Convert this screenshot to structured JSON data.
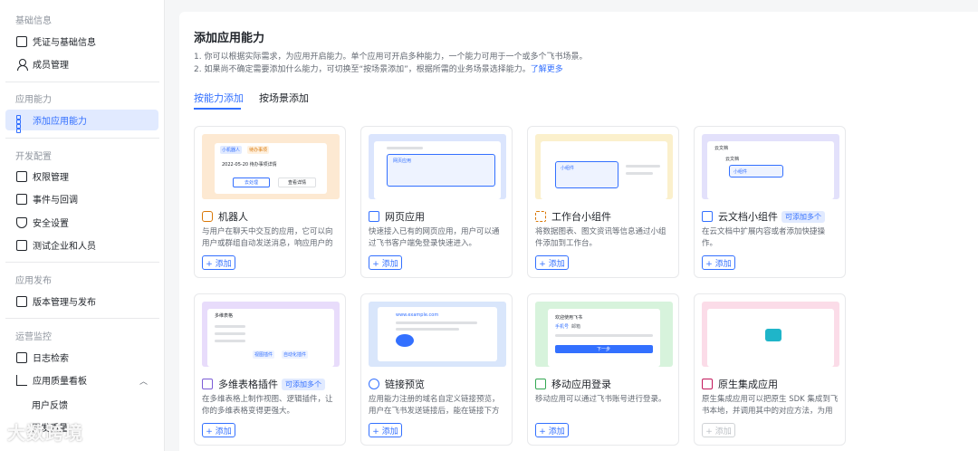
{
  "sidebar": {
    "sections": [
      {
        "title": "基础信息",
        "items": [
          "凭证与基础信息",
          "成员管理"
        ]
      },
      {
        "title": "应用能力",
        "items": [
          "添加应用能力"
        ]
      },
      {
        "title": "开发配置",
        "items": [
          "权限管理",
          "事件与回调",
          "安全设置",
          "测试企业和人员"
        ]
      },
      {
        "title": "应用发布",
        "items": [
          "版本管理与发布"
        ]
      },
      {
        "title": "运营监控",
        "items": [
          "日志检索",
          "应用质量看板"
        ],
        "subitems": [
          "用户反馈",
          "开发质量"
        ]
      }
    ]
  },
  "main": {
    "title": "添加应用能力",
    "desc1": "1. 你可以根据实际需求，为应用开启能力。单个应用可开启多种能力，一个能力可用于一个或多个飞书场景。",
    "desc2": "2. 如果尚不确定需要添加什么能力，可切换至“按场景添加”，根据所需的业务场景选择能力。",
    "learn_more": "了解更多",
    "tabs": [
      "按能力添加",
      "按场景添加"
    ],
    "add_label": "+ 添加",
    "cards": [
      {
        "name": "机器人",
        "badge": "",
        "desc": "与用户在聊天中交互的应用，它可以向用户或群组自动发送消息，响应用户的消..."
      },
      {
        "name": "网页应用",
        "badge": "",
        "desc": "快速接入已有的网页应用，用户可以通过飞书客户端免登录快速进入。"
      },
      {
        "name": "工作台小组件",
        "badge": "",
        "desc": "将数据图表、图文资讯等信息通过小组件添加到工作台。"
      },
      {
        "name": "云文档小组件",
        "badge": "可添加多个",
        "desc": "在云文档中扩展内容或者添加快捷操作。"
      },
      {
        "name": "多维表格插件",
        "badge": "可添加多个",
        "desc": "在多维表格上制作视图、逻辑插件，让你的多维表格变得更强大。"
      },
      {
        "name": "链接预览",
        "badge": "",
        "desc": "应用能力注册的域名自定义链接预览，用户在飞书发送链接后，能在链接下方展示..."
      },
      {
        "name": "移动应用登录",
        "badge": "",
        "desc": "移动应用可以通过飞书账号进行登录。"
      },
      {
        "name": "原生集成应用",
        "badge": "",
        "desc": "原生集成应用可以把原生 SDK 集成到飞书本地，并调用其中的对应方法，为用户提..."
      }
    ],
    "previews": {
      "bot_tag": "小机器人",
      "bot_tag2": "待办事项",
      "bot_time": "2022-05-20 待办事项详情",
      "bot_btn1": "去处理",
      "bot_btn2": "查看详情",
      "web_label": "网页应用",
      "widget_label": "小组件",
      "doc_title": "云文档",
      "doc_sub": "云文档",
      "doc_widget": "小组件",
      "base_title": "多维表格",
      "base_btn1": "视图插件",
      "base_btn2": "自动化插件",
      "link_url": "www.example.com",
      "login_title": "欢迎使用飞书",
      "login_tab1": "手机号",
      "login_tab2": "邮箱",
      "login_btn": "下一步"
    }
  },
  "colors": {
    "accent": "#3370ff",
    "bot_bg": "#fde9d2",
    "web_bg": "#dbe5fd",
    "widget_bg": "#fbf0cc",
    "doc_bg": "#e3e1fb",
    "base_bg": "#e8dcfb",
    "link_bg": "#d9e6fb",
    "login_bg": "#d7f3dc",
    "native_bg": "#fbdce8"
  },
  "watermark": "大数跨境"
}
